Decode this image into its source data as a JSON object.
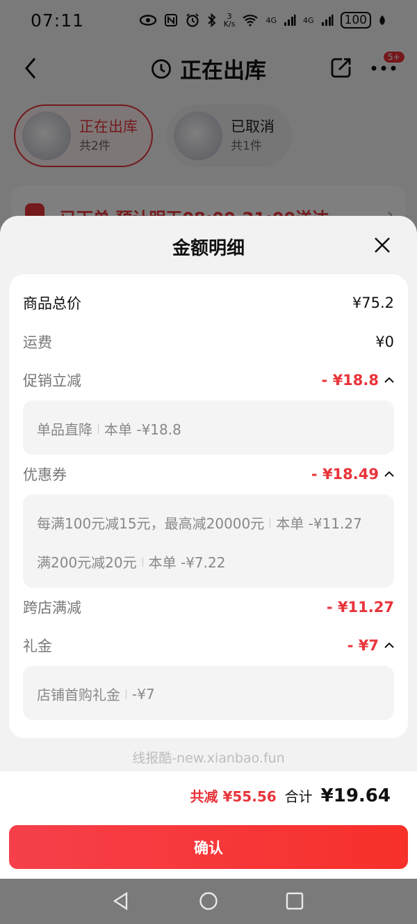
{
  "status_bar": {
    "time": "07:11",
    "net_speed_top": "3",
    "net_speed_unit": "K/s",
    "signal_1": "4G",
    "signal_2": "4G",
    "battery": "100"
  },
  "nav": {
    "title": "正在出库",
    "badge": "5+"
  },
  "packages": [
    {
      "status": "正在出库",
      "count": "共2件",
      "active": true
    },
    {
      "status": "已取消",
      "count": "共1件",
      "active": false
    }
  ],
  "order_strip": {
    "text": "已下单 预计明天08:00-21:00送达"
  },
  "sheet": {
    "title": "金额明细",
    "rows": {
      "goods_total": {
        "label": "商品总价",
        "value": "¥75.2"
      },
      "shipping": {
        "label": "运费",
        "value": "¥0"
      },
      "promo": {
        "label": "促销立减",
        "value": "- ¥18.8"
      },
      "coupon": {
        "label": "优惠券",
        "value": "- ¥18.49"
      },
      "cross_store": {
        "label": "跨店满减",
        "value": "- ¥11.27"
      },
      "gift": {
        "label": "礼金",
        "value": "- ¥7"
      }
    },
    "promo_details": [
      {
        "name": "单品直降",
        "amount": "本单 -¥18.8"
      }
    ],
    "coupon_details": [
      {
        "name": "每满100元减15元，最高减20000元",
        "amount": "本单 -¥11.27"
      },
      {
        "name": "满200元减20元",
        "amount": "本单 -¥7.22"
      }
    ],
    "gift_details": [
      {
        "name": "店铺首购礼金",
        "amount": "-¥7"
      }
    ],
    "watermark": "线报酷-new.xianbao.fun"
  },
  "footer": {
    "total_reduce": "共减 ¥55.56",
    "total_label": "合计",
    "total_value": "¥19.64",
    "confirm_label": "确认"
  },
  "colors": {
    "accent": "#e8343a",
    "confirm_gradient_start": "#f5404a",
    "confirm_gradient_end": "#f7302a"
  }
}
